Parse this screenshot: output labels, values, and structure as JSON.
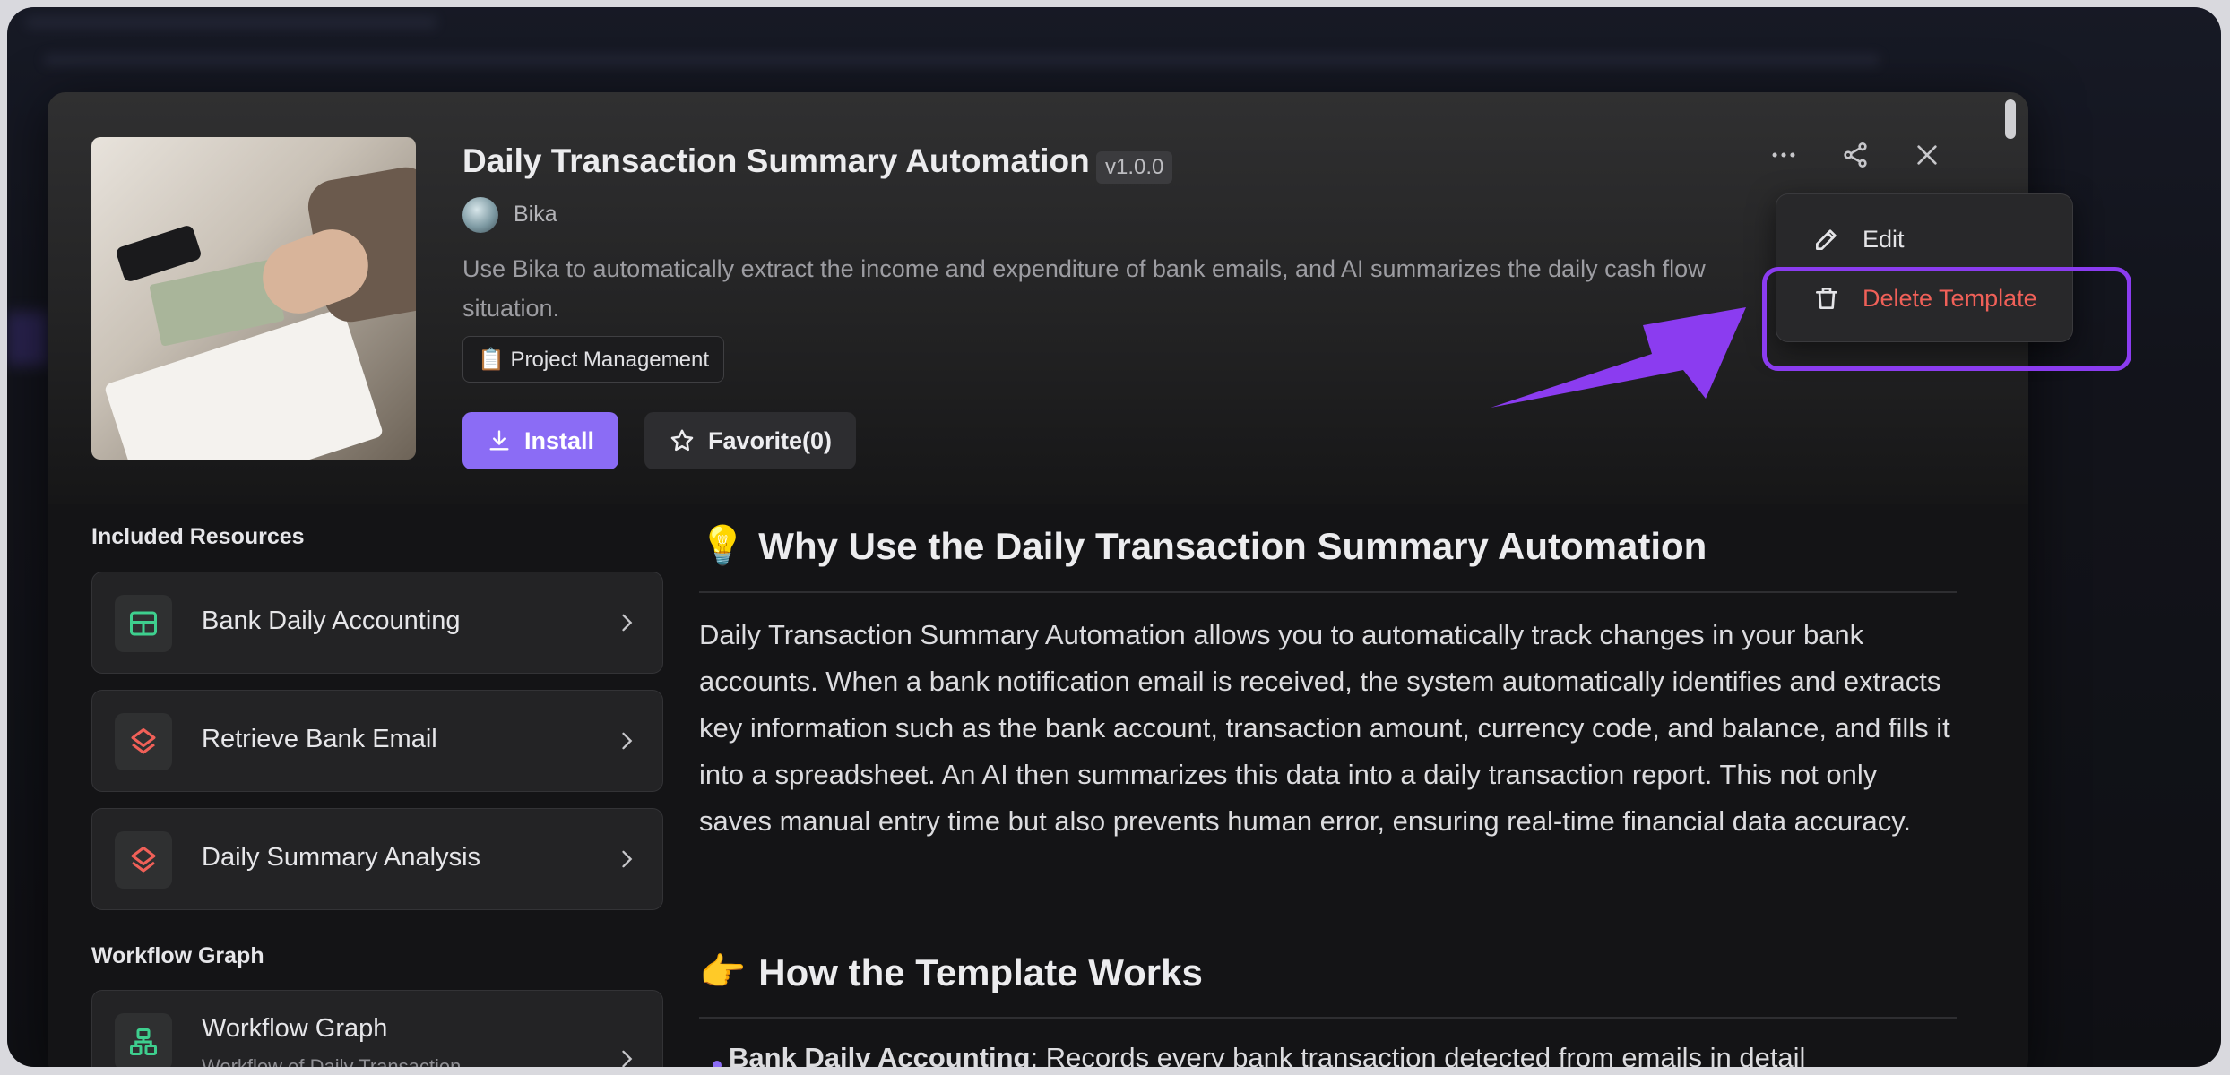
{
  "template": {
    "title": "Daily Transaction Summary Automation",
    "version": "v1.0.0",
    "author": "Bika",
    "description": "Use Bika to automatically extract the income and expenditure of bank emails, and AI summarizes the daily cash flow situation.",
    "tag": "📋 Project Management",
    "install_label": "Install",
    "favorite_label": "Favorite(0)"
  },
  "header_actions": {
    "more_icon": "more-horizontal-icon",
    "share_icon": "share-icon",
    "close_icon": "close-icon"
  },
  "context_menu": {
    "items": [
      {
        "label": "Edit",
        "icon": "pencil-icon"
      },
      {
        "label": "Delete Template",
        "icon": "trash-icon",
        "color": "#f06058"
      }
    ]
  },
  "sidebar": {
    "included_resources_title": "Included Resources",
    "resources": [
      {
        "label": "Bank Daily Accounting",
        "icon": "table-grid-icon",
        "color": "#3ecf8e"
      },
      {
        "label": "Retrieve Bank Email",
        "icon": "automation-layers-icon",
        "color": "#f06058"
      },
      {
        "label": "Daily Summary Analysis",
        "icon": "automation-layers-icon",
        "color": "#f06058"
      }
    ],
    "workflow_title": "Workflow Graph",
    "workflow": {
      "label": "Workflow Graph",
      "sublabel": "Workflow of Daily Transaction",
      "icon": "workflow-icon",
      "color": "#3ecf8e"
    }
  },
  "content": {
    "h2_why_emoji": "💡",
    "h2_why": "Why Use the Daily Transaction Summary Automation",
    "paragraph": "Daily Transaction Summary Automation allows you to automatically track changes in your bank accounts. When a bank notification email is received, the system automatically identifies and extracts key information such as the bank account, transaction amount, currency code, and balance, and fills it into a spreadsheet. An AI then summarizes this data into a daily transaction report. This not only saves manual entry time but also prevents human error, ensuring real-time financial data accuracy.",
    "h2_how_emoji": "👉",
    "h2_how": "How the Template Works",
    "bullet_bold": "Bank Daily Accounting",
    "bullet_rest": ": Records every bank transaction detected from emails in detail"
  },
  "colors": {
    "accent": "#8b6cf5",
    "danger": "#f06058",
    "highlight": "#8b3cf0"
  }
}
